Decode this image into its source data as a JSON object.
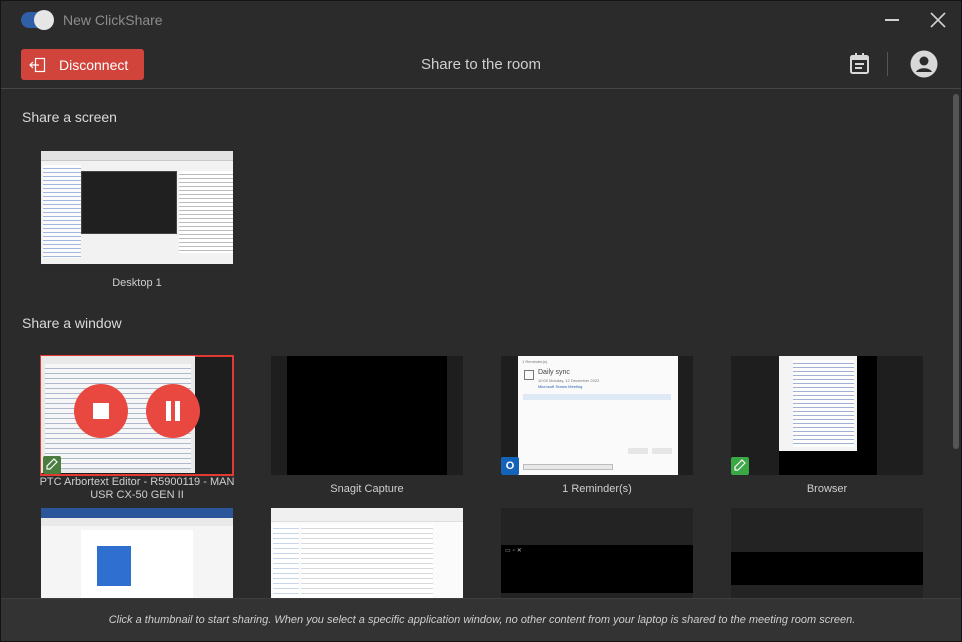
{
  "app": {
    "title": "New ClickShare",
    "toggle_on": true
  },
  "toolbar": {
    "disconnect_label": "Disconnect",
    "title": "Share to the room",
    "calendar_icon": "calendar-icon",
    "account_icon": "account-icon"
  },
  "sections": {
    "screen": {
      "heading": "Share a screen",
      "items": [
        {
          "label": "Desktop 1"
        }
      ]
    },
    "window": {
      "heading": "Share a window",
      "items": [
        {
          "label": "PTC Arbortext Editor - R5900119 - MAN USR CX-50 GEN II",
          "selected": true,
          "badge": "arbortext-icon"
        },
        {
          "label": "Snagit Capture"
        },
        {
          "label": "1 Reminder(s)",
          "badge": "outlook-icon",
          "badge_letter": "O"
        },
        {
          "label": "Browser",
          "badge": "browser-app-icon"
        },
        {
          "label": ""
        },
        {
          "label": ""
        },
        {
          "label": ""
        },
        {
          "label": ""
        }
      ]
    }
  },
  "outlook_preview": {
    "header": "1 Reminder(s)",
    "title": "Daily sync",
    "subtitle": "10:00 Monday, 12 December 2022",
    "link": "Microsoft Teams Meeting",
    "row": "Daily sync"
  },
  "footer": {
    "hint": "Click a thumbnail to start sharing. When you select a specific application window, no other content from your laptop is shared to the meeting room screen."
  },
  "colors": {
    "accent_red": "#d0443c",
    "selected_outline": "#e03a32",
    "toggle_blue": "#2f5fa6",
    "background": "#2b2b2b"
  }
}
